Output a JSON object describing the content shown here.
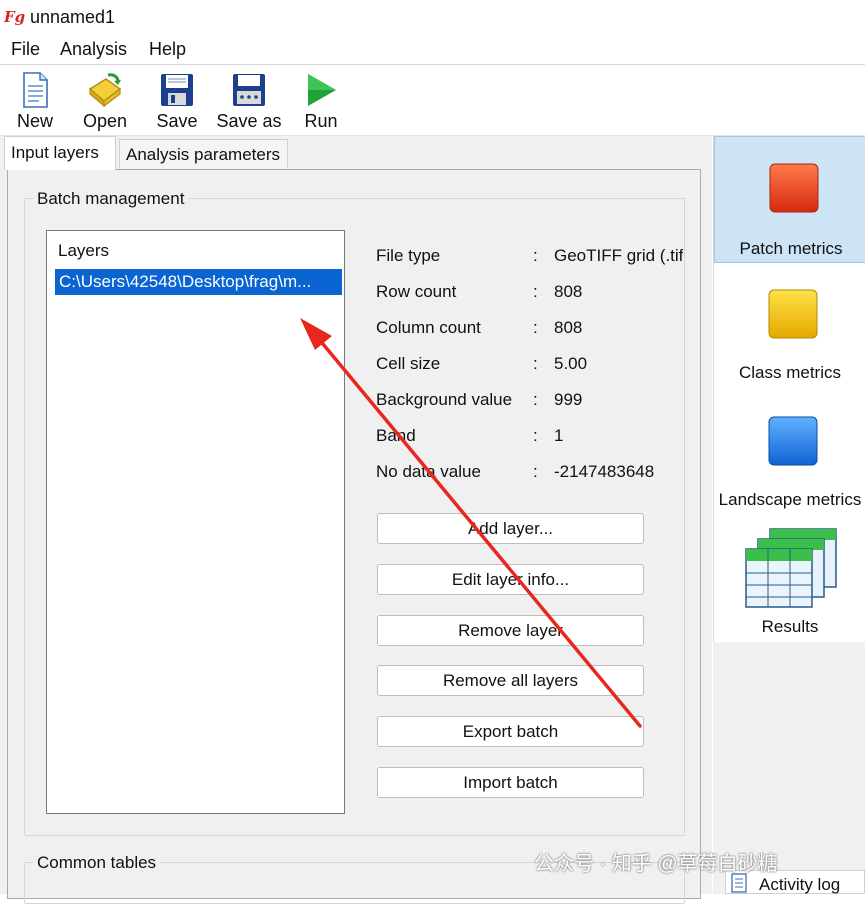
{
  "window": {
    "title": "unnamed1",
    "logo_text": "Fg"
  },
  "menu": [
    "File",
    "Analysis",
    "Help"
  ],
  "toolbar": [
    {
      "label": "New",
      "icon": "new-file-icon"
    },
    {
      "label": "Open",
      "icon": "open-folder-icon"
    },
    {
      "label": "Save",
      "icon": "save-icon"
    },
    {
      "label": "Save as",
      "icon": "save-as-icon"
    },
    {
      "label": "Run",
      "icon": "run-play-icon"
    }
  ],
  "tabs": [
    {
      "label": "Input layers",
      "active": true
    },
    {
      "label": "Analysis parameters",
      "active": false
    }
  ],
  "batch": {
    "title": "Batch management",
    "layers_header": "Layers",
    "layers": [
      "C:\\Users\\42548\\Desktop\\frag\\m..."
    ],
    "info": [
      {
        "label": "File type",
        "value": "GeoTIFF grid (.tif"
      },
      {
        "label": "Row count",
        "value": "808"
      },
      {
        "label": "Column count",
        "value": "808"
      },
      {
        "label": "Cell size",
        "value": "5.00"
      },
      {
        "label": "Background value",
        "value": "999"
      },
      {
        "label": "Band",
        "value": "1"
      },
      {
        "label": "No data value",
        "value": "-2147483648"
      }
    ],
    "colon": ":",
    "buttons": [
      "Add layer...",
      "Edit layer info...",
      "Remove layer",
      "Remove all layers",
      "Export batch",
      "Import batch"
    ]
  },
  "common_tables": {
    "title": "Common tables"
  },
  "metrics": [
    {
      "label": "Patch metrics",
      "color": "#e8401c",
      "selected": true
    },
    {
      "label": "Class metrics",
      "color": "#f2c400",
      "selected": false
    },
    {
      "label": "Landscape metrics",
      "color": "#1f7fe6",
      "selected": false
    },
    {
      "label": "Results",
      "color": "#2aa84a",
      "selected": false
    }
  ],
  "activity_log": {
    "label": "Activity log"
  },
  "watermark": "公众号 · 知乎 @草莓白砂糖",
  "colors": {
    "selection": "#0a64d2",
    "metric_selected_bg": "#cde4f7",
    "arrow": "#e8281e"
  }
}
